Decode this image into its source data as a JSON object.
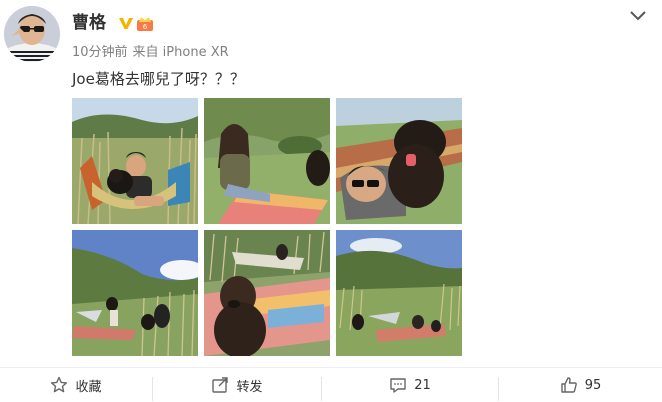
{
  "post": {
    "username": "曹格",
    "time": "10分钟前",
    "source": "来自 iPhone XR",
    "text": "Joe葛格去哪兒了呀？？？"
  },
  "photos": [
    {
      "id": "photo-1",
      "subject": "man-with-poodle-in-hammock"
    },
    {
      "id": "photo-2",
      "subject": "woman-on-picnic-blanket"
    },
    {
      "id": "photo-3",
      "subject": "poodle-selfie-in-hammock"
    },
    {
      "id": "photo-4",
      "subject": "family-on-hillside-meadow"
    },
    {
      "id": "photo-5",
      "subject": "poodle-on-picnic-blanket"
    },
    {
      "id": "photo-6",
      "subject": "picnic-wide-shot"
    }
  ],
  "actions": {
    "favorite_label": "收藏",
    "repost_label": "转发",
    "comment_count": "21",
    "like_count": "95"
  },
  "icons": {
    "verified": "verified-v-icon",
    "member": "crown-member-icon",
    "menu": "chevron-down-icon",
    "favorite": "star-icon",
    "repost": "share-icon",
    "comment": "comment-icon",
    "like": "thumbs-up-icon"
  },
  "colors": {
    "verified": "#f6b400",
    "member": "#f77b43",
    "meta_gray": "#808080"
  }
}
